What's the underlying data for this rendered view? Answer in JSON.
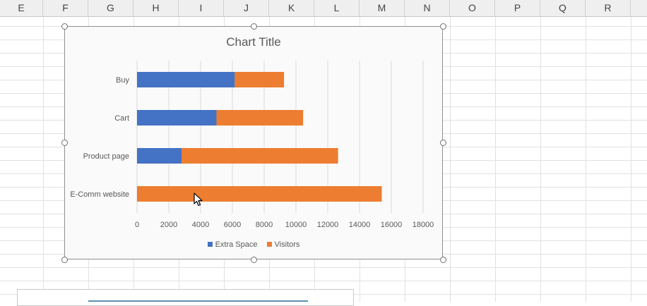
{
  "columns": [
    "E",
    "F",
    "G",
    "H",
    "I",
    "J",
    "K",
    "L",
    "M",
    "N",
    "O",
    "P",
    "Q",
    "R"
  ],
  "chart": {
    "colors": {
      "extra_space": "#4472c4",
      "visitors": "#ed7d31"
    }
  },
  "chart_data": {
    "type": "bar",
    "orientation": "horizontal",
    "stacked": true,
    "title": "Chart Title",
    "categories": [
      "Buy",
      "Cart",
      "Product page",
      "E-Comm website"
    ],
    "series": [
      {
        "name": "Extra Space",
        "values": [
          6150,
          5000,
          2800,
          0
        ]
      },
      {
        "name": "Visitors",
        "values": [
          3100,
          5450,
          9850,
          15400
        ]
      }
    ],
    "xlim": [
      0,
      18000
    ],
    "x_ticks": [
      "0",
      "2000",
      "4000",
      "6000",
      "8000",
      "10000",
      "12000",
      "14000",
      "16000",
      "18000"
    ],
    "grid": true,
    "legend": "bottom"
  }
}
